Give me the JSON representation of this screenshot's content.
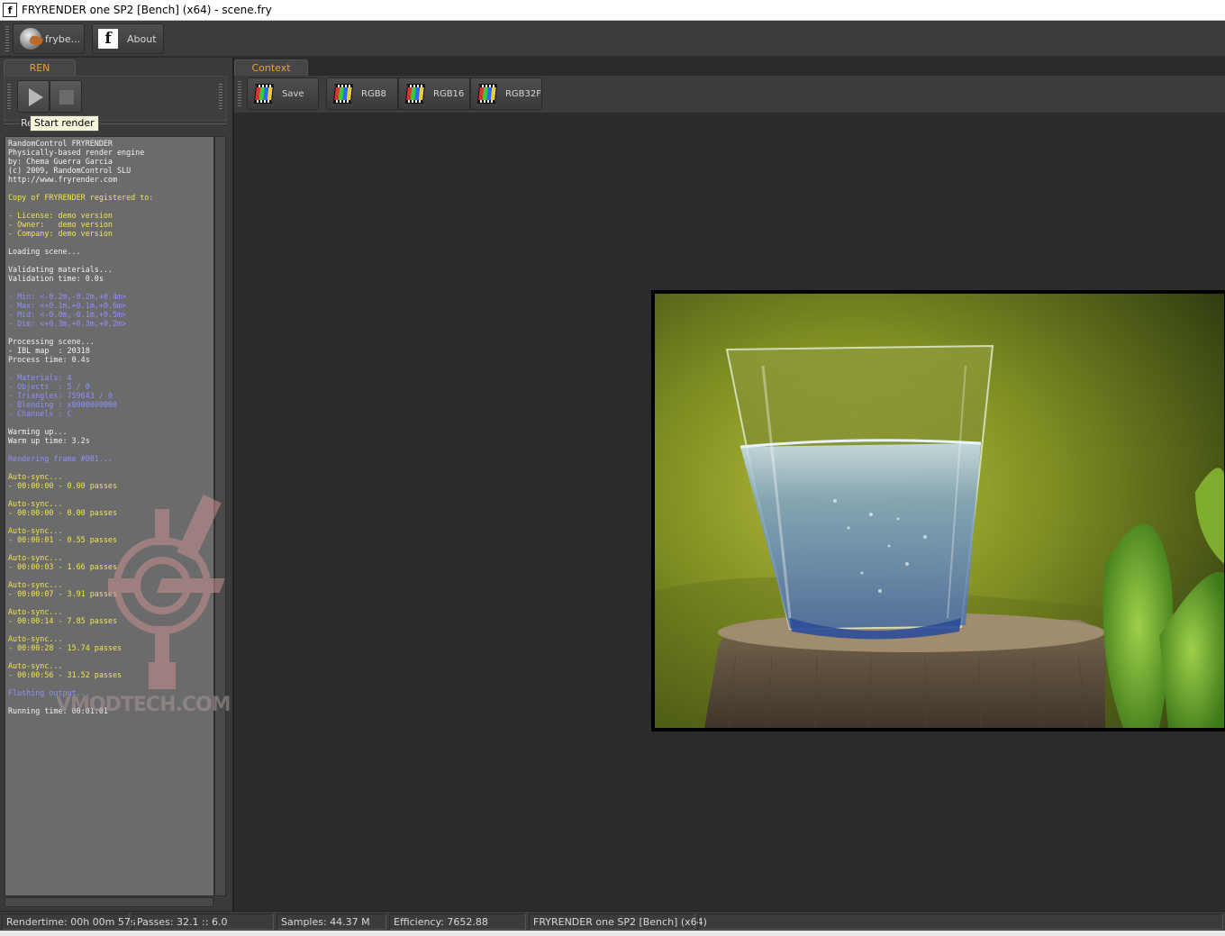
{
  "window": {
    "title": "FRYRENDER one SP2 [Bench] (x64) - scene.fry",
    "icon_letter": "f"
  },
  "toolbar": {
    "fryboost_label": "frybe...",
    "about_label": "About"
  },
  "left_panel": {
    "tab_label": "REN",
    "group_label": "Re",
    "tooltip": "Start render",
    "log": [
      {
        "t": "RandomControl FRYRENDER",
        "c": "white"
      },
      {
        "t": "Physically-based render engine",
        "c": "white"
      },
      {
        "t": "by: Chema Guerra Garcia",
        "c": "white"
      },
      {
        "t": "(c) 2009, RandomControl SLU",
        "c": "white"
      },
      {
        "t": "http://www.fryrender.com",
        "c": "white"
      },
      {
        "t": "",
        "c": "blank"
      },
      {
        "t": "Copy of FRYRENDER registered to:",
        "c": "yellow"
      },
      {
        "t": "",
        "c": "blank"
      },
      {
        "t": "- License: demo version",
        "c": "yellow"
      },
      {
        "t": "- Owner:   demo version",
        "c": "yellow"
      },
      {
        "t": "- Company: demo version",
        "c": "yellow"
      },
      {
        "t": "",
        "c": "blank"
      },
      {
        "t": "Loading scene...",
        "c": "white"
      },
      {
        "t": "",
        "c": "blank"
      },
      {
        "t": "Validating materials...",
        "c": "white"
      },
      {
        "t": "Validation time: 0.0s",
        "c": "white"
      },
      {
        "t": "",
        "c": "blank"
      },
      {
        "t": "- Min: <-0.2m,-0.2m,+0.4m>",
        "c": "blue"
      },
      {
        "t": "- Max: <+0.1m,+0.1m,+0.6m>",
        "c": "blue"
      },
      {
        "t": "- Mid: <-0.0m,-0.1m,+0.5m>",
        "c": "blue"
      },
      {
        "t": "- Dim: <+0.3m,+0.3m,+0.2m>",
        "c": "blue"
      },
      {
        "t": "",
        "c": "blank"
      },
      {
        "t": "Processing scene...",
        "c": "white"
      },
      {
        "t": "- IBL map  : 20318",
        "c": "white"
      },
      {
        "t": "Process time: 0.4s",
        "c": "white"
      },
      {
        "t": "",
        "c": "blank"
      },
      {
        "t": "- Materials: 4",
        "c": "blue"
      },
      {
        "t": "- Objects  : 5 / 0",
        "c": "blue"
      },
      {
        "t": "- Triangles: 759643 / 0",
        "c": "blue"
      },
      {
        "t": "- Blending : x0000000000",
        "c": "blue"
      },
      {
        "t": "- Channels : C",
        "c": "blue"
      },
      {
        "t": "",
        "c": "blank"
      },
      {
        "t": "Warming up...",
        "c": "white"
      },
      {
        "t": "Warm up time: 3.2s",
        "c": "white"
      },
      {
        "t": "",
        "c": "blank"
      },
      {
        "t": "Rendering frame #001...",
        "c": "blue"
      },
      {
        "t": "",
        "c": "blank"
      },
      {
        "t": "Auto-sync...",
        "c": "yellow"
      },
      {
        "t": "- 00:00:00 - 0.00 passes",
        "c": "yellow"
      },
      {
        "t": "",
        "c": "blank"
      },
      {
        "t": "Auto-sync...",
        "c": "yellow"
      },
      {
        "t": "- 00:00:00 - 0.00 passes",
        "c": "yellow"
      },
      {
        "t": "",
        "c": "blank"
      },
      {
        "t": "Auto-sync...",
        "c": "yellow"
      },
      {
        "t": "- 00:00:01 - 0.55 passes",
        "c": "yellow"
      },
      {
        "t": "",
        "c": "blank"
      },
      {
        "t": "Auto-sync...",
        "c": "yellow"
      },
      {
        "t": "- 00:00:03 - 1.66 passes",
        "c": "yellow"
      },
      {
        "t": "",
        "c": "blank"
      },
      {
        "t": "Auto-sync...",
        "c": "yellow"
      },
      {
        "t": "- 00:00:07 - 3.91 passes",
        "c": "yellow"
      },
      {
        "t": "",
        "c": "blank"
      },
      {
        "t": "Auto-sync...",
        "c": "yellow"
      },
      {
        "t": "- 00:00:14 - 7.85 passes",
        "c": "yellow"
      },
      {
        "t": "",
        "c": "blank"
      },
      {
        "t": "Auto-sync...",
        "c": "yellow"
      },
      {
        "t": "- 00:00:28 - 15.74 passes",
        "c": "yellow"
      },
      {
        "t": "",
        "c": "blank"
      },
      {
        "t": "Auto-sync...",
        "c": "yellow"
      },
      {
        "t": "- 00:00:56 - 31.52 passes",
        "c": "yellow"
      },
      {
        "t": "",
        "c": "blank"
      },
      {
        "t": "Flushing output...",
        "c": "blue"
      },
      {
        "t": "",
        "c": "blank"
      },
      {
        "t": "Running time: 00:01:01",
        "c": "white"
      }
    ],
    "watermark_text": "VMODTECH.COM"
  },
  "right_panel": {
    "tab_label": "Context",
    "save_label": "Save",
    "rgb8_label": "RGB8",
    "rgb16_label": "RGB16",
    "rgb32f_label": "RGB32F"
  },
  "status": {
    "rendertime_label": "Rendertime:",
    "rendertime_value": "00h 00m 57s",
    "passes_label": "Passes:",
    "passes_value": "32.1 :: 6.0",
    "samples_label": "Samples:",
    "samples_value": "44.37 M",
    "efficiency_label": "Efficiency:",
    "efficiency_value": "7652.88",
    "app_label": "FRYRENDER one SP2 [Bench] (x64)"
  }
}
